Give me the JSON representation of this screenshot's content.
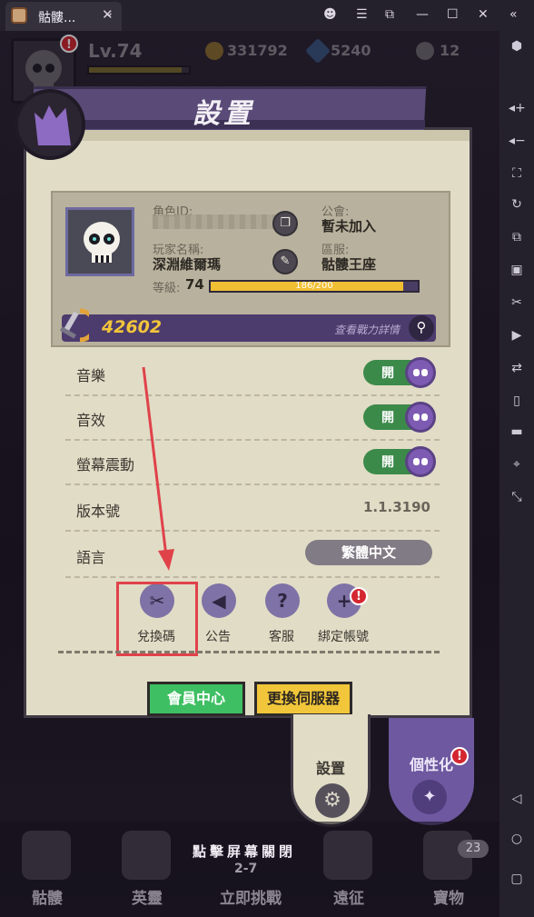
{
  "window": {
    "tab_title": "骷髏...",
    "tab_close": "✕",
    "tab_dropdown": "⌄",
    "controls": {
      "account": "☻",
      "menu": "☰",
      "restore_window": "⧉",
      "minimize": "—",
      "maximize": "☐",
      "close": "✕",
      "collapse": "«"
    }
  },
  "sidebar_icons": [
    "settings-icon",
    "volume-up-icon",
    "volume-down-icon",
    "screenshot-icon",
    "rotate-icon",
    "multi-instance-icon",
    "apk-icon",
    "cut-icon",
    "record-icon",
    "sync-icon",
    "shake-icon",
    "folder-icon",
    "location-icon",
    "resize-icon",
    "back-icon",
    "home-icon",
    "recent-icon"
  ],
  "hud": {
    "level": "Lv.74",
    "level_progress": 0.93,
    "gold": "331792",
    "gems": "5240",
    "skulls": "12",
    "power": "42602",
    "alert": "!"
  },
  "panel": {
    "title": "設置",
    "profile": {
      "role_id_label": "角色ID:",
      "guild_label": "公會:",
      "guild_value": "暫未加入",
      "name_label": "玩家名稱:",
      "name_value": "深淵維爾瑪",
      "server_label": "區服:",
      "server_value": "骷髏王座",
      "level_label": "等級:",
      "level_value": "74",
      "xp_text": "186/200",
      "xp_progress": 0.93,
      "power_value": "42602",
      "power_detail": "查看戰力詳情"
    },
    "settings": {
      "music_label": "音樂",
      "music_toggle": "開",
      "sfx_label": "音效",
      "sfx_toggle": "開",
      "vibration_label": "螢幕震動",
      "vibration_toggle": "開",
      "version_label": "版本號",
      "version_value": "1.1.3190",
      "language_label": "語言",
      "language_value": "繁體中文"
    },
    "icon_buttons": [
      {
        "label": "兌換碼",
        "icon": "redeem-icon"
      },
      {
        "label": "公告",
        "icon": "megaphone-icon"
      },
      {
        "label": "客服",
        "icon": "question-icon"
      },
      {
        "label": "綁定帳號",
        "icon": "bind-account-icon",
        "alert": "!"
      }
    ],
    "member_center": "會員中心",
    "change_server": "更換伺服器"
  },
  "tabs": {
    "settings": "設置",
    "personalize": "個性化",
    "personalize_alert": "!"
  },
  "bottom": {
    "tap_close": "點擊屏幕關閉",
    "stage": "2-7",
    "nav": [
      "骷髏",
      "英靈",
      "立即挑戰",
      "遠征",
      "寶物"
    ],
    "treasure_count": "23"
  },
  "colors": {
    "accent_purple": "#6e58a0",
    "annotation_red": "#e0424a",
    "toggle_green": "#3c8a4a",
    "gold": "#f0bf33"
  }
}
